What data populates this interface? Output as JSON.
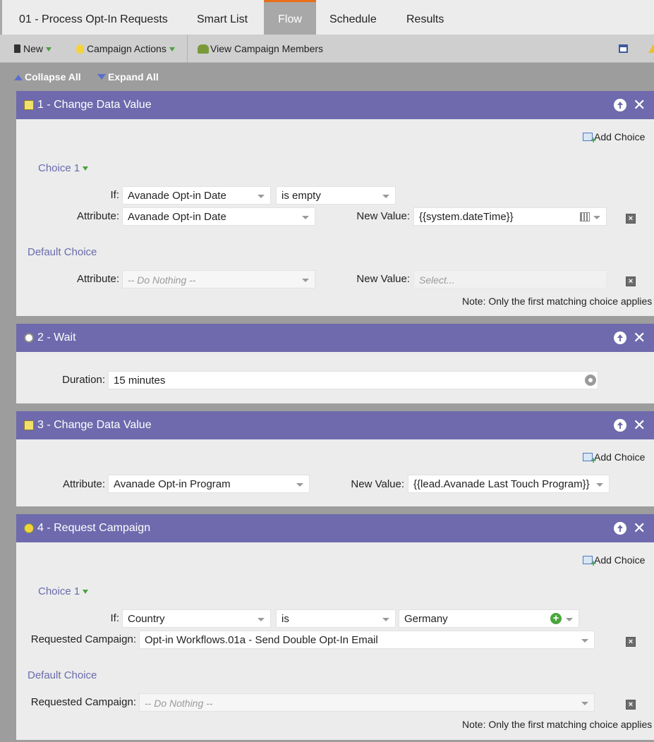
{
  "tabs": [
    "01 - Process Opt-In Requests",
    "Smart List",
    "Flow",
    "Schedule",
    "Results"
  ],
  "active_tab": "Flow",
  "accent_color": "#e96e1a",
  "step_header_color": "#6e6aad",
  "toolbar": {
    "new_label": "New",
    "campaign_actions_label": "Campaign Actions",
    "view_members_label": "View Campaign Members"
  },
  "expand": {
    "collapse_all": "Collapse All",
    "expand_all": "Expand All"
  },
  "steps": [
    {
      "title": "1 - Change Data Value",
      "icon": "edit-data-icon",
      "add_choice": "Add Choice",
      "choice_label": "Choice 1",
      "if_label": "If:",
      "if_field": "Avanade Opt-in Date",
      "if_operator": "is empty",
      "attribute_label": "Attribute:",
      "attribute_value": "Avanade Opt-in Date",
      "new_value_label": "New Value:",
      "new_value": "{{system.dateTime}}",
      "default_label": "Default Choice",
      "default_attribute_value": "-- Do Nothing --",
      "default_new_value_placeholder": "Select...",
      "note": "Note: Only the first matching choice applies"
    },
    {
      "title": "2 - Wait",
      "icon": "clock-icon",
      "duration_label": "Duration:",
      "duration_value": "15 minutes"
    },
    {
      "title": "3 - Change Data Value",
      "icon": "edit-data-icon",
      "add_choice": "Add Choice",
      "attribute_label": "Attribute:",
      "attribute_value": "Avanade Opt-in Program",
      "new_value_label": "New Value:",
      "new_value": "{{lead.Avanade Last Touch Program}}"
    },
    {
      "title": "4 - Request Campaign",
      "icon": "lightbulb-icon",
      "add_choice": "Add Choice",
      "choice_label": "Choice 1",
      "if_label": "If:",
      "if_field": "Country",
      "if_operator": "is",
      "if_value": "Germany",
      "requested_label": "Requested Campaign:",
      "requested_value": "Opt-in Workflows.01a - Send Double Opt-In Email",
      "default_label": "Default Choice",
      "default_requested_value": "-- Do Nothing --",
      "note": "Note: Only the first matching choice applies"
    }
  ]
}
